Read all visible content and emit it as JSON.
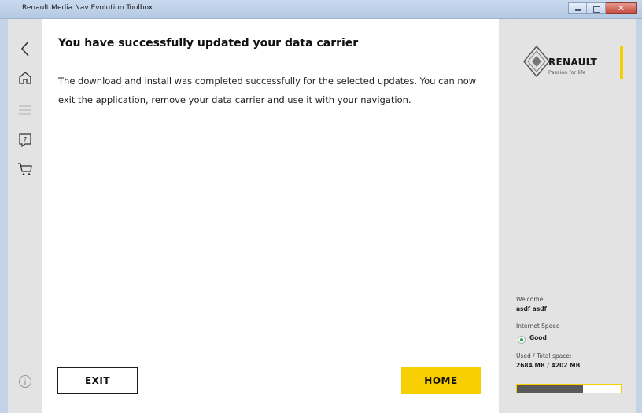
{
  "window": {
    "title": "Renault Media Nav Evolution Toolbox"
  },
  "main": {
    "title": "You have successfully updated your data carrier",
    "message": "The download and install was completed successfully for the selected updates. You can now exit the application, remove your data carrier and use it with your navigation.",
    "exit_label": "EXIT",
    "home_label": "HOME"
  },
  "brand": {
    "name": "RENAULT",
    "tagline": "Passion for life"
  },
  "account": {
    "welcome_label": "Welcome",
    "user_name": "asdf asdf",
    "speed_label": "Internet Speed",
    "speed_value": "Good",
    "space_label": "Used / Total space:",
    "space_value": "2684 MB / 4202 MB",
    "space_used_fraction": 0.639
  },
  "icons": [
    "back-icon",
    "home-icon",
    "menu-icon",
    "help-icon",
    "cart-icon",
    "info-icon"
  ],
  "colors": {
    "accent_yellow": "#f7cf00",
    "status_good": "#2aa24a",
    "panel_gray": "#e3e3e3"
  }
}
